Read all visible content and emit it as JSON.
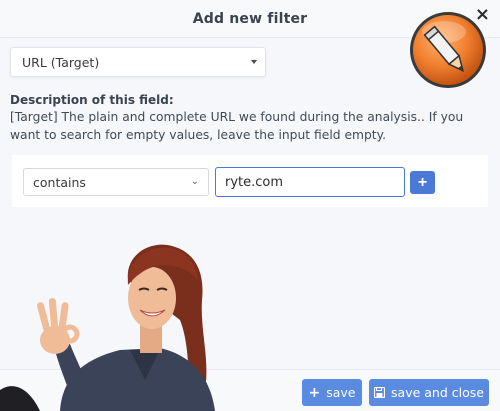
{
  "modal": {
    "title": "Add new filter",
    "close_label": "×"
  },
  "field_select": {
    "value": "URL (Target)"
  },
  "description": {
    "title": "Description of this field:",
    "text": "[Target] The plain and complete URL we found during the analysis.. If you want to search for empty values, leave the input field empty."
  },
  "filter_row": {
    "operator": "contains",
    "value": "ryte.com",
    "add_label": "+"
  },
  "footer": {
    "save_label": "save",
    "save_close_label": "save and close"
  },
  "icons": {
    "badge": "pencil-icon",
    "save_plus": "plus-icon",
    "save_close": "floppy-disk-icon"
  },
  "colors": {
    "primary": "#4a79d6",
    "button": "#5b8be0",
    "badge_orange": "#f07d2e"
  }
}
